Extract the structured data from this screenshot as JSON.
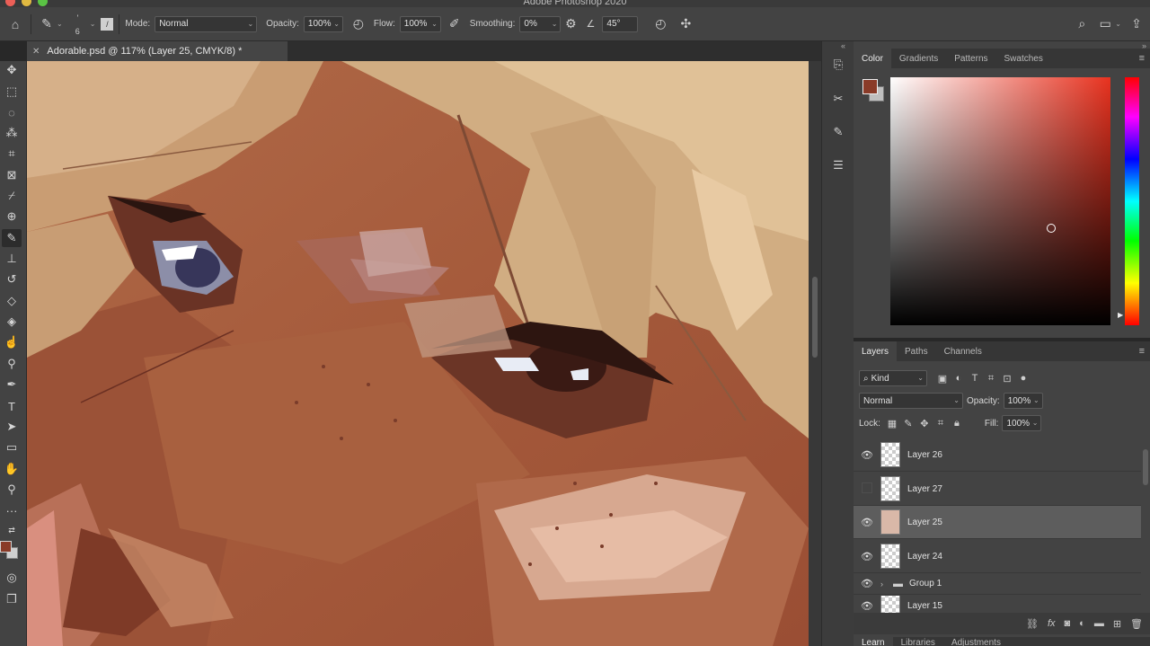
{
  "app": {
    "title": "Adobe Photoshop 2020"
  },
  "options_bar": {
    "brush_size": "6",
    "mode_label": "Mode:",
    "mode_value": "Normal",
    "opacity_label": "Opacity:",
    "opacity_value": "100%",
    "flow_label": "Flow:",
    "flow_value": "100%",
    "smoothing_label": "Smoothing:",
    "smoothing_value": "0%",
    "angle_value": "45°"
  },
  "document": {
    "tab_title": "Adorable.psd @ 117% (Layer 25, CMYK/8) *"
  },
  "color_panel": {
    "tabs": [
      "Color",
      "Gradients",
      "Patterns",
      "Swatches"
    ],
    "foreground_color": "#8a3b28",
    "background_color": "#bfbfbf"
  },
  "layers_panel": {
    "tabs": [
      "Layers",
      "Paths",
      "Channels"
    ],
    "filter_kind": "Kind",
    "blend_mode": "Normal",
    "opacity_label": "Opacity:",
    "opacity_value": "100%",
    "lock_label": "Lock:",
    "fill_label": "Fill:",
    "fill_value": "100%",
    "layers": [
      {
        "name": "Layer 26",
        "visible": true,
        "selected": false
      },
      {
        "name": "Layer 27",
        "visible": false,
        "selected": false
      },
      {
        "name": "Layer 25",
        "visible": true,
        "selected": true
      },
      {
        "name": "Layer 24",
        "visible": true,
        "selected": false
      },
      {
        "name": "Group 1",
        "visible": true,
        "selected": false,
        "group": true
      },
      {
        "name": "Layer 15",
        "visible": true,
        "selected": false
      }
    ]
  },
  "bottom_panel": {
    "tabs": [
      "Learn",
      "Libraries",
      "Adjustments"
    ]
  }
}
